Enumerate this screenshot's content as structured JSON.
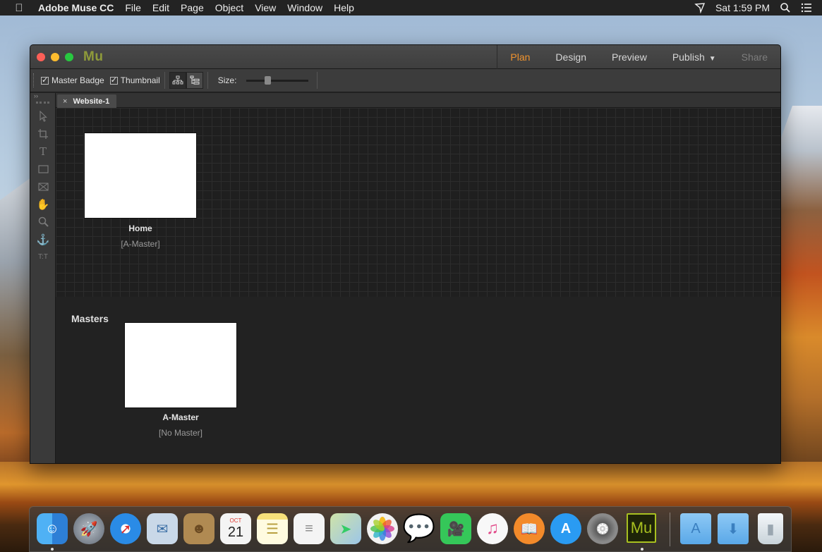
{
  "menubar": {
    "app_name": "Adobe Muse CC",
    "items": [
      "File",
      "Edit",
      "Page",
      "Object",
      "View",
      "Window",
      "Help"
    ],
    "clock": "Sat 1:59 PM"
  },
  "window": {
    "logo": "Mu",
    "modes": [
      {
        "label": "Plan",
        "state": "active"
      },
      {
        "label": "Design",
        "state": "normal"
      },
      {
        "label": "Preview",
        "state": "normal"
      },
      {
        "label": "Publish",
        "state": "normal"
      },
      {
        "label": "Share",
        "state": "disabled"
      }
    ],
    "accent_color": "#f0932e"
  },
  "toolbar": {
    "master_badge_label": "Master Badge",
    "master_badge_checked": true,
    "thumbnail_label": "Thumbnail",
    "thumbnail_checked": true,
    "size_label": "Size:",
    "size_value": 0.3
  },
  "document_tab": {
    "close_label": "×",
    "title": "Website-1"
  },
  "sitemap": {
    "pages": [
      {
        "name": "Home",
        "master": "[A-Master]"
      }
    ]
  },
  "masters": {
    "title": "Masters",
    "items": [
      {
        "name": "A-Master",
        "master": "[No Master]"
      }
    ]
  },
  "tools": [
    "selection-icon",
    "crop-icon",
    "text-icon",
    "rectangle-icon",
    "image-frame-icon",
    "hand-icon",
    "zoom-icon",
    "anchor-icon",
    "text-frames-icon"
  ],
  "dock": {
    "apps": [
      {
        "name": "Finder",
        "icon": "finder-icon",
        "color": "#3a8ee6",
        "running": true
      },
      {
        "name": "Launchpad",
        "icon": "launchpad-icon",
        "color": "#8a96a6"
      },
      {
        "name": "Safari",
        "icon": "safari-icon",
        "color": "#2a8be6"
      },
      {
        "name": "Mail",
        "icon": "mail-icon",
        "color": "#6fa0d0"
      },
      {
        "name": "Contacts",
        "icon": "contacts-icon",
        "color": "#b08a52"
      },
      {
        "name": "Calendar",
        "icon": "calendar-icon",
        "color": "#f4f4f4",
        "month": "OCT",
        "day": "21"
      },
      {
        "name": "Notes",
        "icon": "notes-icon",
        "color": "#f7e07a"
      },
      {
        "name": "Reminders",
        "icon": "reminders-icon",
        "color": "#f4f4f4"
      },
      {
        "name": "Maps",
        "icon": "maps-icon",
        "color": "#cfe3a8"
      },
      {
        "name": "Photos",
        "icon": "photos-icon",
        "color": "#f2f2f2"
      },
      {
        "name": "Messages",
        "icon": "messages-icon",
        "color": "#3aa7f2"
      },
      {
        "name": "FaceTime",
        "icon": "facetime-icon",
        "color": "#35c759"
      },
      {
        "name": "iTunes",
        "icon": "itunes-icon",
        "color": "#f8f8f8"
      },
      {
        "name": "iBooks",
        "icon": "ibooks-icon",
        "color": "#f38a2a"
      },
      {
        "name": "App Store",
        "icon": "appstore-icon",
        "color": "#2a9bf2"
      },
      {
        "name": "System Preferences",
        "icon": "system-preferences-icon",
        "color": "#7a7a7a"
      },
      {
        "name": "Adobe Muse",
        "icon": "muse-icon",
        "color": "#1e2408",
        "label": "Mu",
        "running": true
      }
    ],
    "stacks": [
      {
        "name": "Applications",
        "icon": "applications-folder-icon",
        "color": "#7bbcf0"
      },
      {
        "name": "Downloads",
        "icon": "downloads-folder-icon",
        "color": "#7bbcf0"
      },
      {
        "name": "Trash",
        "icon": "trash-icon",
        "color": "#e8eef2"
      }
    ]
  }
}
